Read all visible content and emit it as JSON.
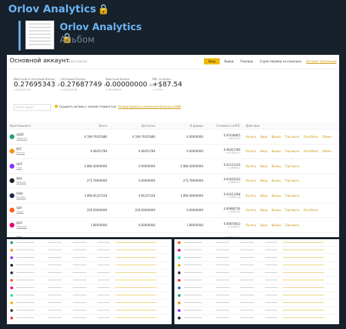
{
  "channel": {
    "name": "Orlov Analytics",
    "lock": "🔒"
  },
  "reply": {
    "title": "Orlov Analytics",
    "lock": "🔒",
    "subtitle": "Альбом"
  },
  "screenshot": {
    "title": "Основной аккаунт",
    "hide_label": "Скрыть баланс",
    "buttons": [
      "Ввод",
      "Вывод",
      "Перевод",
      "Crypto перевод на кошельки"
    ],
    "link": "Истории транзакций",
    "balances": [
      {
        "label": "Фиатный и спотовый баланс",
        "value": "0.27695343",
        "unit": "BTC",
        "sub": "≈ $16,020.00"
      },
      {
        "label": "Спотовый баланс",
        "value": "0.27687749",
        "unit": "BTC",
        "sub": "≈ $16,019.56"
      },
      {
        "label": "Фиатный баланс",
        "value": "0.00000000",
        "unit": "BTC",
        "sub": "≈ $0.000000"
      },
      {
        "label": "PNL за вчера",
        "value": "+$87.54",
        "unit": "",
        "sub": "+ 0.55%"
      }
    ],
    "search_placeholder": "Поиск монет",
    "hide_small": "Скрывать активы с низкой стоимостью",
    "convert_link": "Конвертировать маленькие балансы в BNB",
    "columns": [
      "Криптовалюта",
      "Всего",
      "Доступно",
      "В ордере",
      "Стоимость в BTC",
      "Действие"
    ],
    "rows": [
      {
        "ticker": "USDT",
        "name": "TetherUS",
        "color": "#26a17b",
        "total": "6 199.79325486",
        "avail": "6 199.79325486",
        "order": "0.00000000",
        "btc": "0.07036665",
        "usd": "≈ $6,199.4",
        "actions": [
          "Купить",
          "Ввод",
          "Вывод",
          "Торговать",
          "Earn/Store",
          "Обмен"
        ]
      },
      {
        "ticker": "BTC",
        "name": "Bitcoin",
        "color": "#f7931a",
        "total": "0.06451789",
        "avail": "0.06451789",
        "order": "0.00000000",
        "btc": "0.06451789",
        "usd": "≈ $3,818.15",
        "actions": [
          "Купить",
          "Ввод",
          "Вывод",
          "Торговать",
          "Earn/Store",
          "Обмен"
        ]
      },
      {
        "ticker": "HOT",
        "name": "Holo",
        "color": "#8834ff",
        "total": "5 880.00000000",
        "avail": "0.00000000",
        "order": "5 880.00000000",
        "btc": "0.01111120",
        "usd": "≈ $656.01",
        "actions": [
          "Купить",
          "Ввод",
          "Вывод",
          "Торговать"
        ]
      },
      {
        "ticker": "NAS",
        "name": "Nebulas",
        "color": "#222222",
        "total": "273.78000000",
        "avail": "0.00000000",
        "order": "273.78000000",
        "btc": "0.01020102",
        "usd": "≈ $602.27",
        "actions": [
          "Купить",
          "Ввод",
          "Вывод",
          "Торговать"
        ]
      },
      {
        "ticker": "FIDA",
        "name": "Bonfida",
        "color": "#1d2b4f",
        "total": "3 890.81227228",
        "avail": "0.81227228",
        "order": "3 890.00000000",
        "btc": "0.01011298",
        "usd": "≈ $597.09",
        "actions": [
          "Купить",
          "Ввод",
          "Вывод",
          "Торговать"
        ]
      },
      {
        "ticker": "SXP",
        "name": "Swipe",
        "color": "#ff5a1f",
        "total": "229.00000000",
        "avail": "229.00000000",
        "order": "0.00000000",
        "btc": "0.00986756",
        "usd": "≈ $582.61",
        "actions": [
          "Купить",
          "Ввод",
          "Вывод",
          "Торговать",
          "Earn/Store"
        ]
      },
      {
        "ticker": "DOT",
        "name": "Polkadot",
        "color": "#e6007a",
        "total": "1.89500000",
        "avail": "0.00000000",
        "order": "1.89500000",
        "btc": "0.00874813",
        "usd": "≈ $516.51",
        "actions": [
          "Купить",
          "Ввод",
          "Вывод",
          "Торговать"
        ]
      },
      {
        "ticker": "SOL",
        "name": "Solana",
        "color": "#14f195",
        "total": "6.24700000",
        "avail": "0.00000000",
        "order": "6.24700000",
        "btc": "0.00734908",
        "usd": "≈ $433.91",
        "actions": [
          "Купить",
          "Ввод",
          "Вывод",
          "Торговать"
        ]
      }
    ]
  },
  "thumb_colors": [
    "#26a17b",
    "#f7931a",
    "#8834ff",
    "#222222",
    "#1d2b4f",
    "#ff5a1f",
    "#e6007a",
    "#14f195",
    "#f0b90b",
    "#3c3c3d",
    "#e84142",
    "#2775ca"
  ]
}
